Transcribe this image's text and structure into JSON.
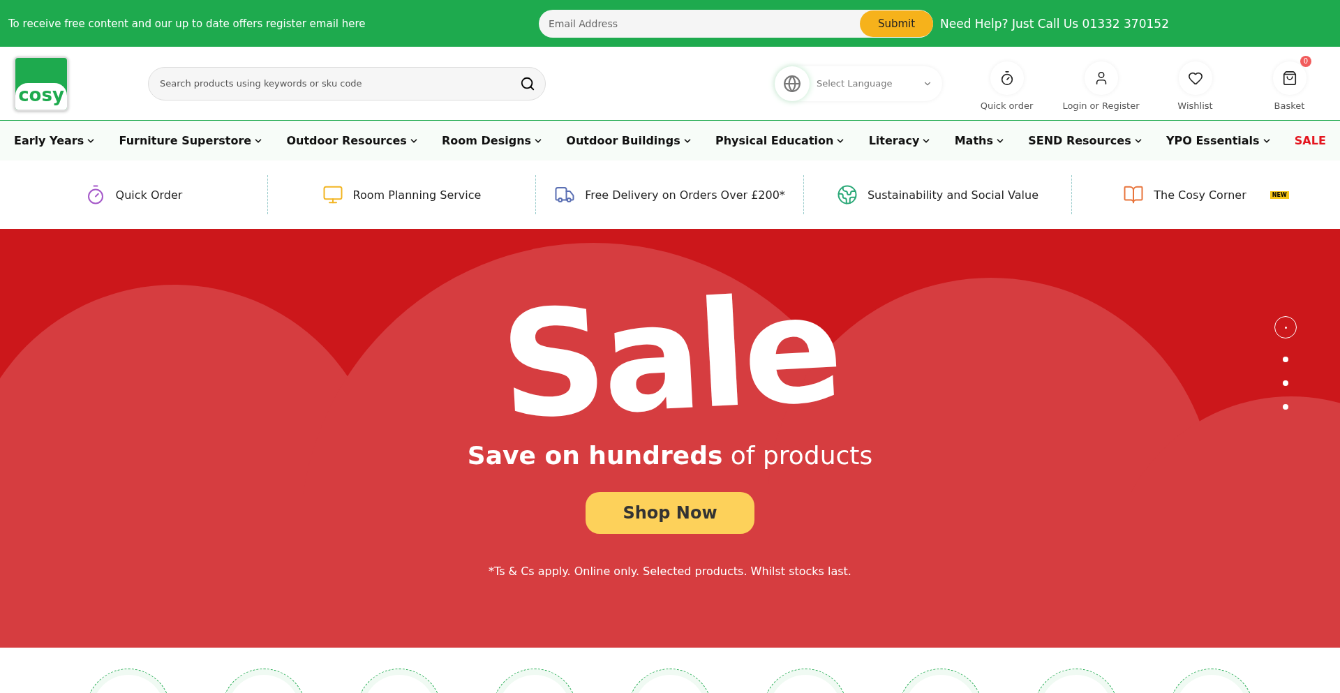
{
  "promo_bar": {
    "message": "To receive free content and our up to date offers register email here",
    "email": {
      "placeholder": "Email Address"
    },
    "submit": "Submit",
    "help": "Need Help? Just Call Us 01332 370152"
  },
  "header": {
    "logo": "cosy",
    "search": {
      "placeholder": "Search products using keywords or sku code"
    },
    "language": "Select Language",
    "actions": [
      {
        "kind": "quick",
        "label": "Quick order"
      },
      {
        "kind": "user",
        "label": "Login or Register"
      },
      {
        "kind": "wishlist",
        "label": "Wishlist"
      },
      {
        "kind": "basket",
        "label": "Basket",
        "badge": "0"
      }
    ]
  },
  "nav": [
    {
      "label": "Early Years",
      "dropdown": true
    },
    {
      "label": "Furniture Superstore",
      "dropdown": true
    },
    {
      "label": "Outdoor Resources",
      "dropdown": true
    },
    {
      "label": "Room Designs",
      "dropdown": true
    },
    {
      "label": "Outdoor Buildings",
      "dropdown": true
    },
    {
      "label": "Physical Education",
      "dropdown": true
    },
    {
      "label": "Literacy",
      "dropdown": true
    },
    {
      "label": "Maths",
      "dropdown": true
    },
    {
      "label": "SEND Resources",
      "dropdown": true
    },
    {
      "label": "YPO Essentials",
      "dropdown": true
    },
    {
      "label": "SALE",
      "dropdown": false,
      "kind": "sale"
    }
  ],
  "features": [
    {
      "kind": "stopwatch",
      "label": "Quick Order"
    },
    {
      "kind": "monitor",
      "label": "Room Planning Service"
    },
    {
      "kind": "truck",
      "label": "Free Delivery on Orders Over £200*"
    },
    {
      "kind": "globe",
      "label": "Sustainability and Social Value"
    },
    {
      "kind": "book",
      "label": "The Cosy Corner",
      "badge": "NEW"
    }
  ],
  "hero": {
    "title": "Sale",
    "subtitle": "**Save on hundreds** of products",
    "button": "Shop Now",
    "note": "*Ts & Cs apply. Online only. Selected products. Whilst stocks last.",
    "slides": [
      {
        "selected": true
      },
      {
        "selected": false
      },
      {
        "selected": false
      },
      {
        "selected": false
      }
    ]
  }
}
